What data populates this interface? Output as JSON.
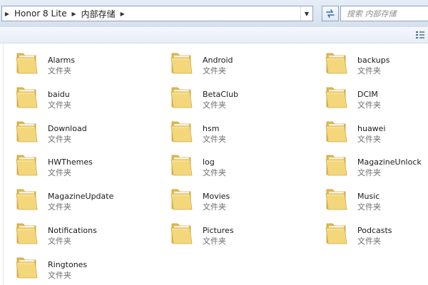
{
  "address_bar": {
    "breadcrumbs": [
      "Honor 8 Lite",
      "内部存储"
    ]
  },
  "search": {
    "placeholder": "搜索 内部存储"
  },
  "folder_type_label": "文件夹",
  "items": [
    {
      "name": "Alarms",
      "type": "文件夹"
    },
    {
      "name": "Android",
      "type": "文件夹"
    },
    {
      "name": "backups",
      "type": "文件夹"
    },
    {
      "name": "baidu",
      "type": "文件夹"
    },
    {
      "name": "BetaClub",
      "type": "文件夹"
    },
    {
      "name": "DCIM",
      "type": "文件夹"
    },
    {
      "name": "Download",
      "type": "文件夹"
    },
    {
      "name": "hsm",
      "type": "文件夹"
    },
    {
      "name": "huawei",
      "type": "文件夹"
    },
    {
      "name": "HWThemes",
      "type": "文件夹"
    },
    {
      "name": "log",
      "type": "文件夹"
    },
    {
      "name": "MagazineUnlock",
      "type": "文件夹"
    },
    {
      "name": "MagazineUpdate",
      "type": "文件夹"
    },
    {
      "name": "Movies",
      "type": "文件夹"
    },
    {
      "name": "Music",
      "type": "文件夹"
    },
    {
      "name": "Notifications",
      "type": "文件夹"
    },
    {
      "name": "Pictures",
      "type": "文件夹"
    },
    {
      "name": "Podcasts",
      "type": "文件夹"
    },
    {
      "name": "Ringtones",
      "type": "文件夹"
    }
  ],
  "icons": {
    "folder": "folder-icon",
    "refresh": "refresh-icon",
    "search": "search-icon",
    "view": "view-options-icon"
  },
  "colors": {
    "folder_front": "#f3d77a",
    "folder_back": "#e2b94a",
    "address_border": "#8ea6c2"
  }
}
